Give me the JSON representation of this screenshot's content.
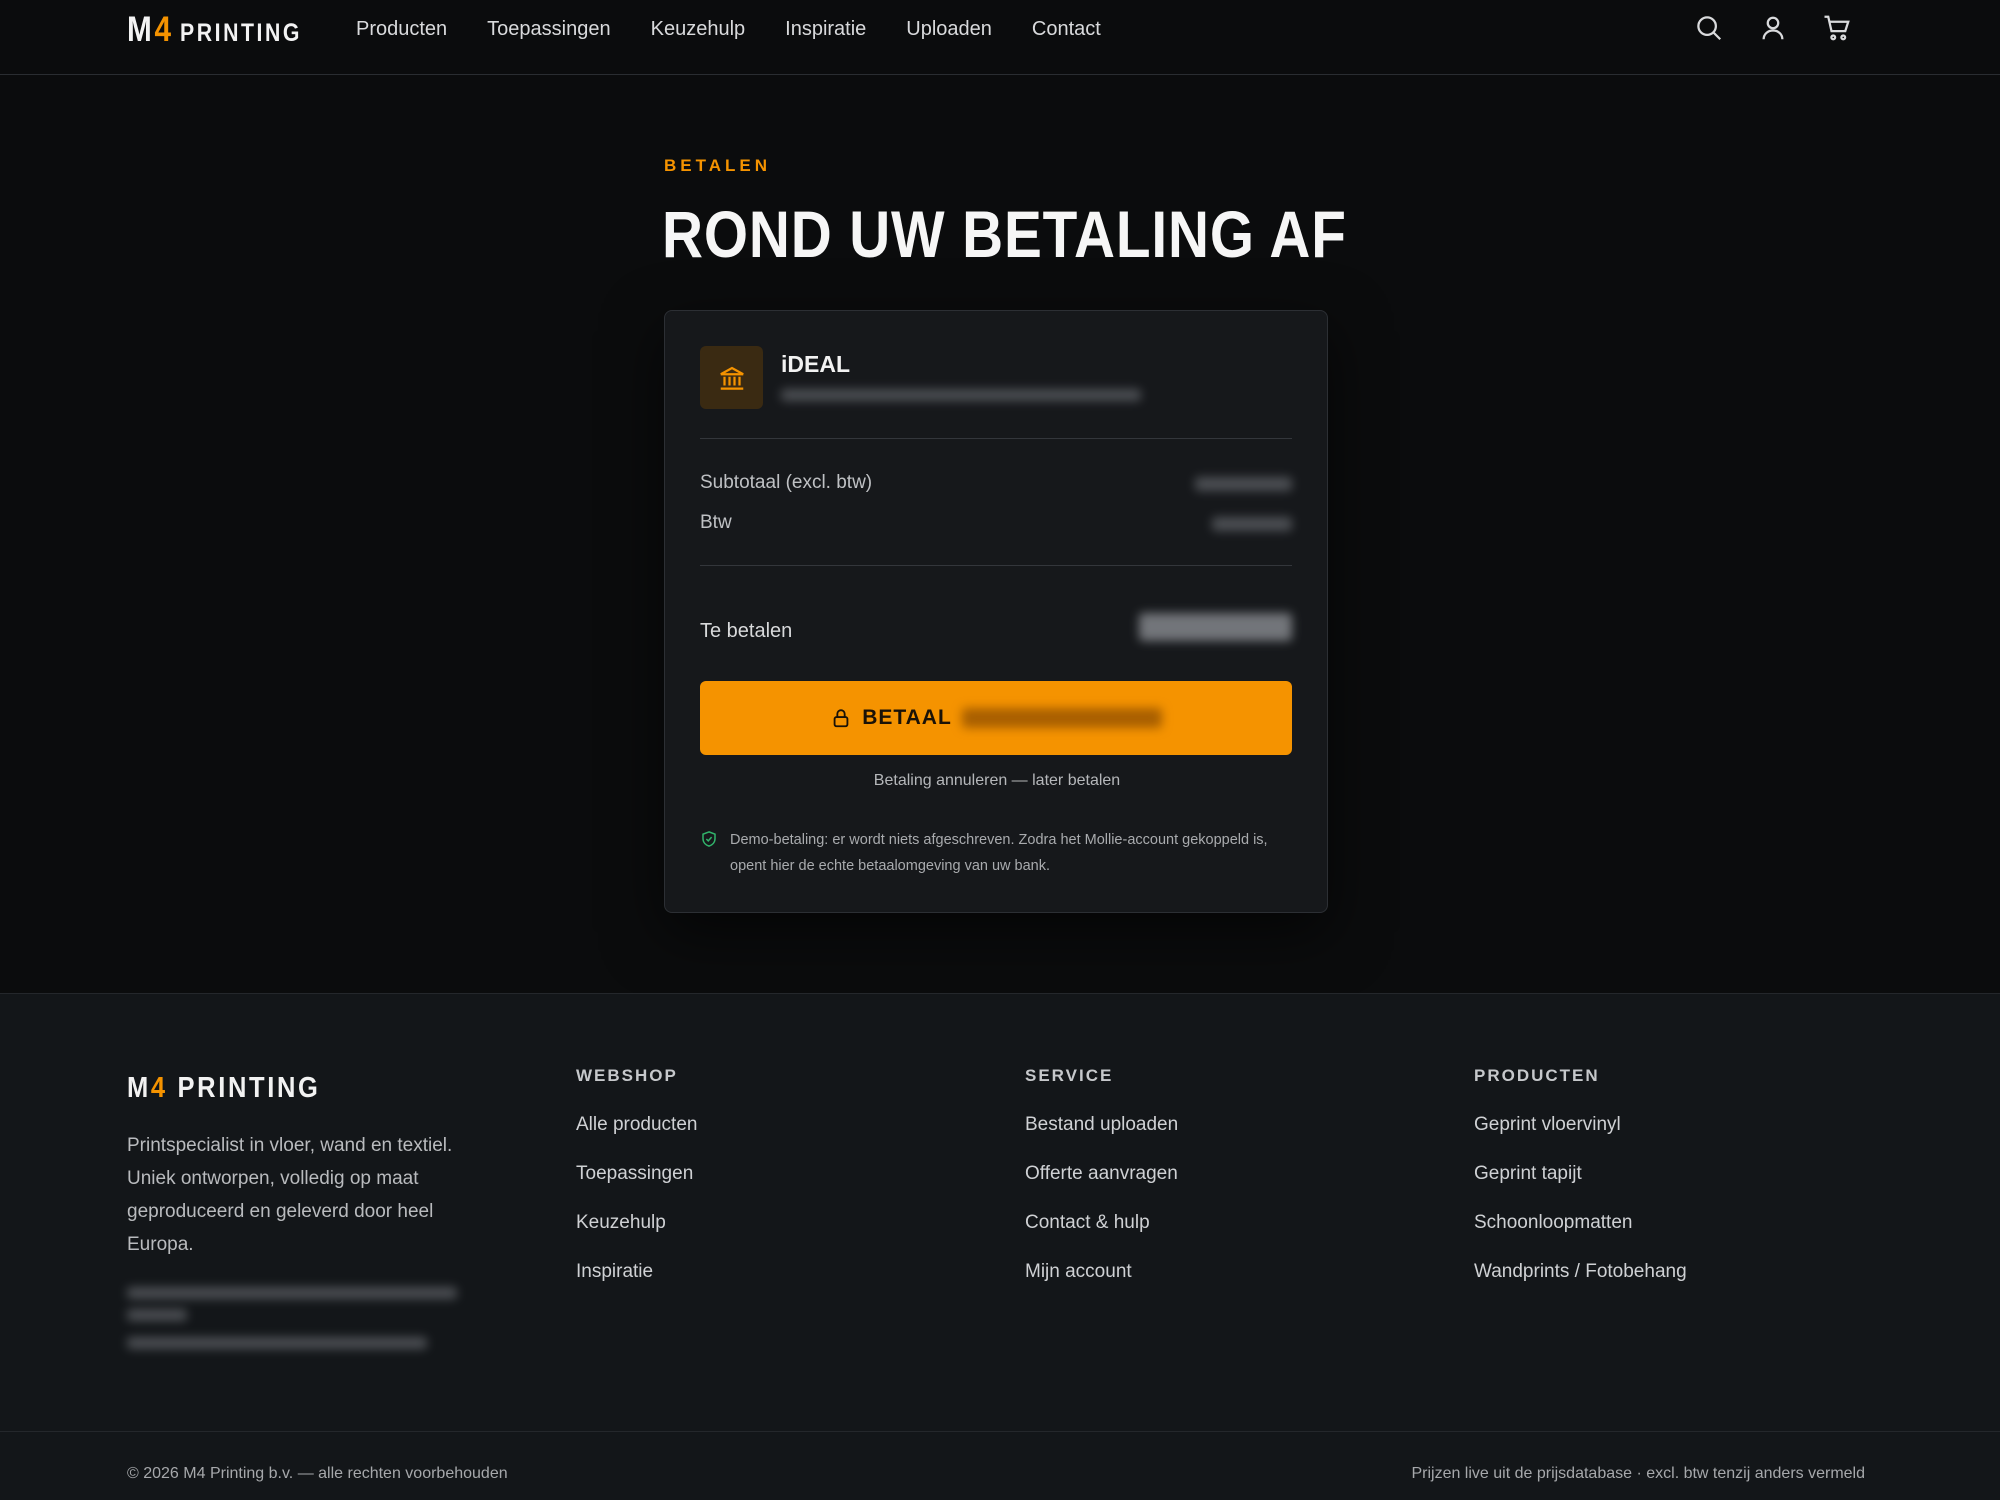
{
  "brand": {
    "logo_m": "M",
    "logo_four": "4",
    "logo_word": "PRINTING",
    "accent_color": "#f59300"
  },
  "nav": {
    "items": [
      "Producten",
      "Toepassingen",
      "Keuzehulp",
      "Inspiratie",
      "Uploaden",
      "Contact"
    ]
  },
  "header_icons": [
    "search-icon",
    "user-icon",
    "cart-icon"
  ],
  "main": {
    "eyebrow": "BETALEN",
    "title": "ROND UW BETALING AF"
  },
  "payment": {
    "method_name": "iDEAL",
    "method_icon": "bank-icon",
    "subtotal_label": "Subtotaal (excl. btw)",
    "vat_label": "Btw",
    "total_label": "Te betalen",
    "pay_button_label": "BETAAL",
    "cancel_link": "Betaling annuleren — later betalen",
    "demo_note": "Demo-betaling: er wordt niets afgeschreven. Zodra het Mollie-account gekoppeld is, opent hier de echte betaalomgeving van uw bank."
  },
  "footer": {
    "logo_m": "M",
    "logo_four": "4",
    "logo_word": "PRINTING",
    "about": "Printspecialist in vloer, wand en textiel. Uniek ontworpen, volledig op maat geproduceerd en geleverd door heel Europa.",
    "columns": [
      {
        "title": "WEBSHOP",
        "links": [
          "Alle producten",
          "Toepassingen",
          "Keuzehulp",
          "Inspiratie"
        ]
      },
      {
        "title": "SERVICE",
        "links": [
          "Bestand uploaden",
          "Offerte aanvragen",
          "Contact & hulp",
          "Mijn account"
        ]
      },
      {
        "title": "PRODUCTEN",
        "links": [
          "Geprint vloervinyl",
          "Geprint tapijt",
          "Schoonloopmatten",
          "Wandprints / Fotobehang"
        ]
      }
    ],
    "copyright": "© 2026 M4 Printing b.v. — alle rechten voorbehouden",
    "price_note": "Prijzen live uit de prijsdatabase · excl. btw tenzij anders vermeld"
  }
}
